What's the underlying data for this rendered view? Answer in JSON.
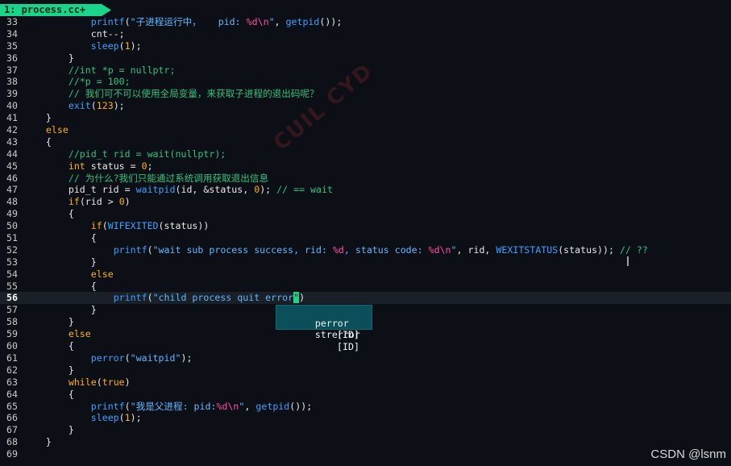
{
  "tab": {
    "label": "1: process.cc+"
  },
  "lines": [
    {
      "n": "33",
      "indent": "            ",
      "t": "printf(\"子进程运行中，   pid: %d\\n\", getpid());"
    },
    {
      "n": "34",
      "indent": "            ",
      "t": "cnt--;"
    },
    {
      "n": "35",
      "indent": "            ",
      "t": "sleep(1);"
    },
    {
      "n": "36",
      "indent": "        ",
      "t": "}"
    },
    {
      "n": "37",
      "indent": "        ",
      "t": "//int *p = nullptr;"
    },
    {
      "n": "38",
      "indent": "        ",
      "t": "//*p = 100;"
    },
    {
      "n": "39",
      "indent": "        ",
      "t": "// 我们可不可以使用全局变量，来获取子进程的退出码呢？"
    },
    {
      "n": "40",
      "indent": "        ",
      "t": "exit(123);"
    },
    {
      "n": "41",
      "indent": "    ",
      "t": "}"
    },
    {
      "n": "42",
      "indent": "    ",
      "t": "else"
    },
    {
      "n": "43",
      "indent": "    ",
      "t": "{"
    },
    {
      "n": "44",
      "indent": "        ",
      "t": "//pid_t rid = wait(nullptr);"
    },
    {
      "n": "45",
      "indent": "        ",
      "t": "int status = 0;"
    },
    {
      "n": "46",
      "indent": "        ",
      "t": "// 为什么?我们只能通过系统调用获取退出信息"
    },
    {
      "n": "47",
      "indent": "        ",
      "t": "pid_t rid = waitpid(id, &status, 0); // == wait"
    },
    {
      "n": "48",
      "indent": "        ",
      "t": "if(rid > 0)"
    },
    {
      "n": "49",
      "indent": "        ",
      "t": "{"
    },
    {
      "n": "50",
      "indent": "            ",
      "t": "if(WIFEXITED(status))"
    },
    {
      "n": "51",
      "indent": "            ",
      "t": "{"
    },
    {
      "n": "52",
      "indent": "                ",
      "t": "printf(\"wait sub process success, rid: %d, status code: %d\\n\", rid, WEXITSTATUS(status)); // ??"
    },
    {
      "n": "53",
      "indent": "            ",
      "t": "}"
    },
    {
      "n": "54",
      "indent": "            ",
      "t": "else"
    },
    {
      "n": "55",
      "indent": "            ",
      "t": "{"
    },
    {
      "n": "56",
      "indent": "                ",
      "t": "printf(\"child process quit error\")"
    },
    {
      "n": "57",
      "indent": "            ",
      "t": "}"
    },
    {
      "n": "58",
      "indent": "        ",
      "t": "}"
    },
    {
      "n": "59",
      "indent": "        ",
      "t": "else"
    },
    {
      "n": "60",
      "indent": "        ",
      "t": "{"
    },
    {
      "n": "61",
      "indent": "            ",
      "t": "perror(\"waitpid\");"
    },
    {
      "n": "62",
      "indent": "        ",
      "t": "}"
    },
    {
      "n": "63",
      "indent": "        ",
      "t": "while(true)"
    },
    {
      "n": "64",
      "indent": "        ",
      "t": "{"
    },
    {
      "n": "65",
      "indent": "            ",
      "t": "printf(\"我是父进程: pid:%d\\n\", getpid());"
    },
    {
      "n": "66",
      "indent": "            ",
      "t": "sleep(1);"
    },
    {
      "n": "67",
      "indent": "        ",
      "t": "}"
    },
    {
      "n": "68",
      "indent": "    ",
      "t": "}"
    },
    {
      "n": "69",
      "indent": "",
      "t": ""
    }
  ],
  "current_line": "56",
  "completion": {
    "items": [
      {
        "word": "perror",
        "kind": "[ID]"
      },
      {
        "word": "strerror",
        "kind": "[ID]"
      }
    ]
  },
  "watermark": "CUIL  CYD",
  "credit": "CSDN @lsnm",
  "colors": {
    "background": "#0c1016",
    "tab": "#19d58c",
    "keyword": "#ffb000",
    "function": "#3aa0ff",
    "comment": "#2ec27e",
    "format": "#ff4ba3",
    "popup": "#0b4f5a"
  }
}
